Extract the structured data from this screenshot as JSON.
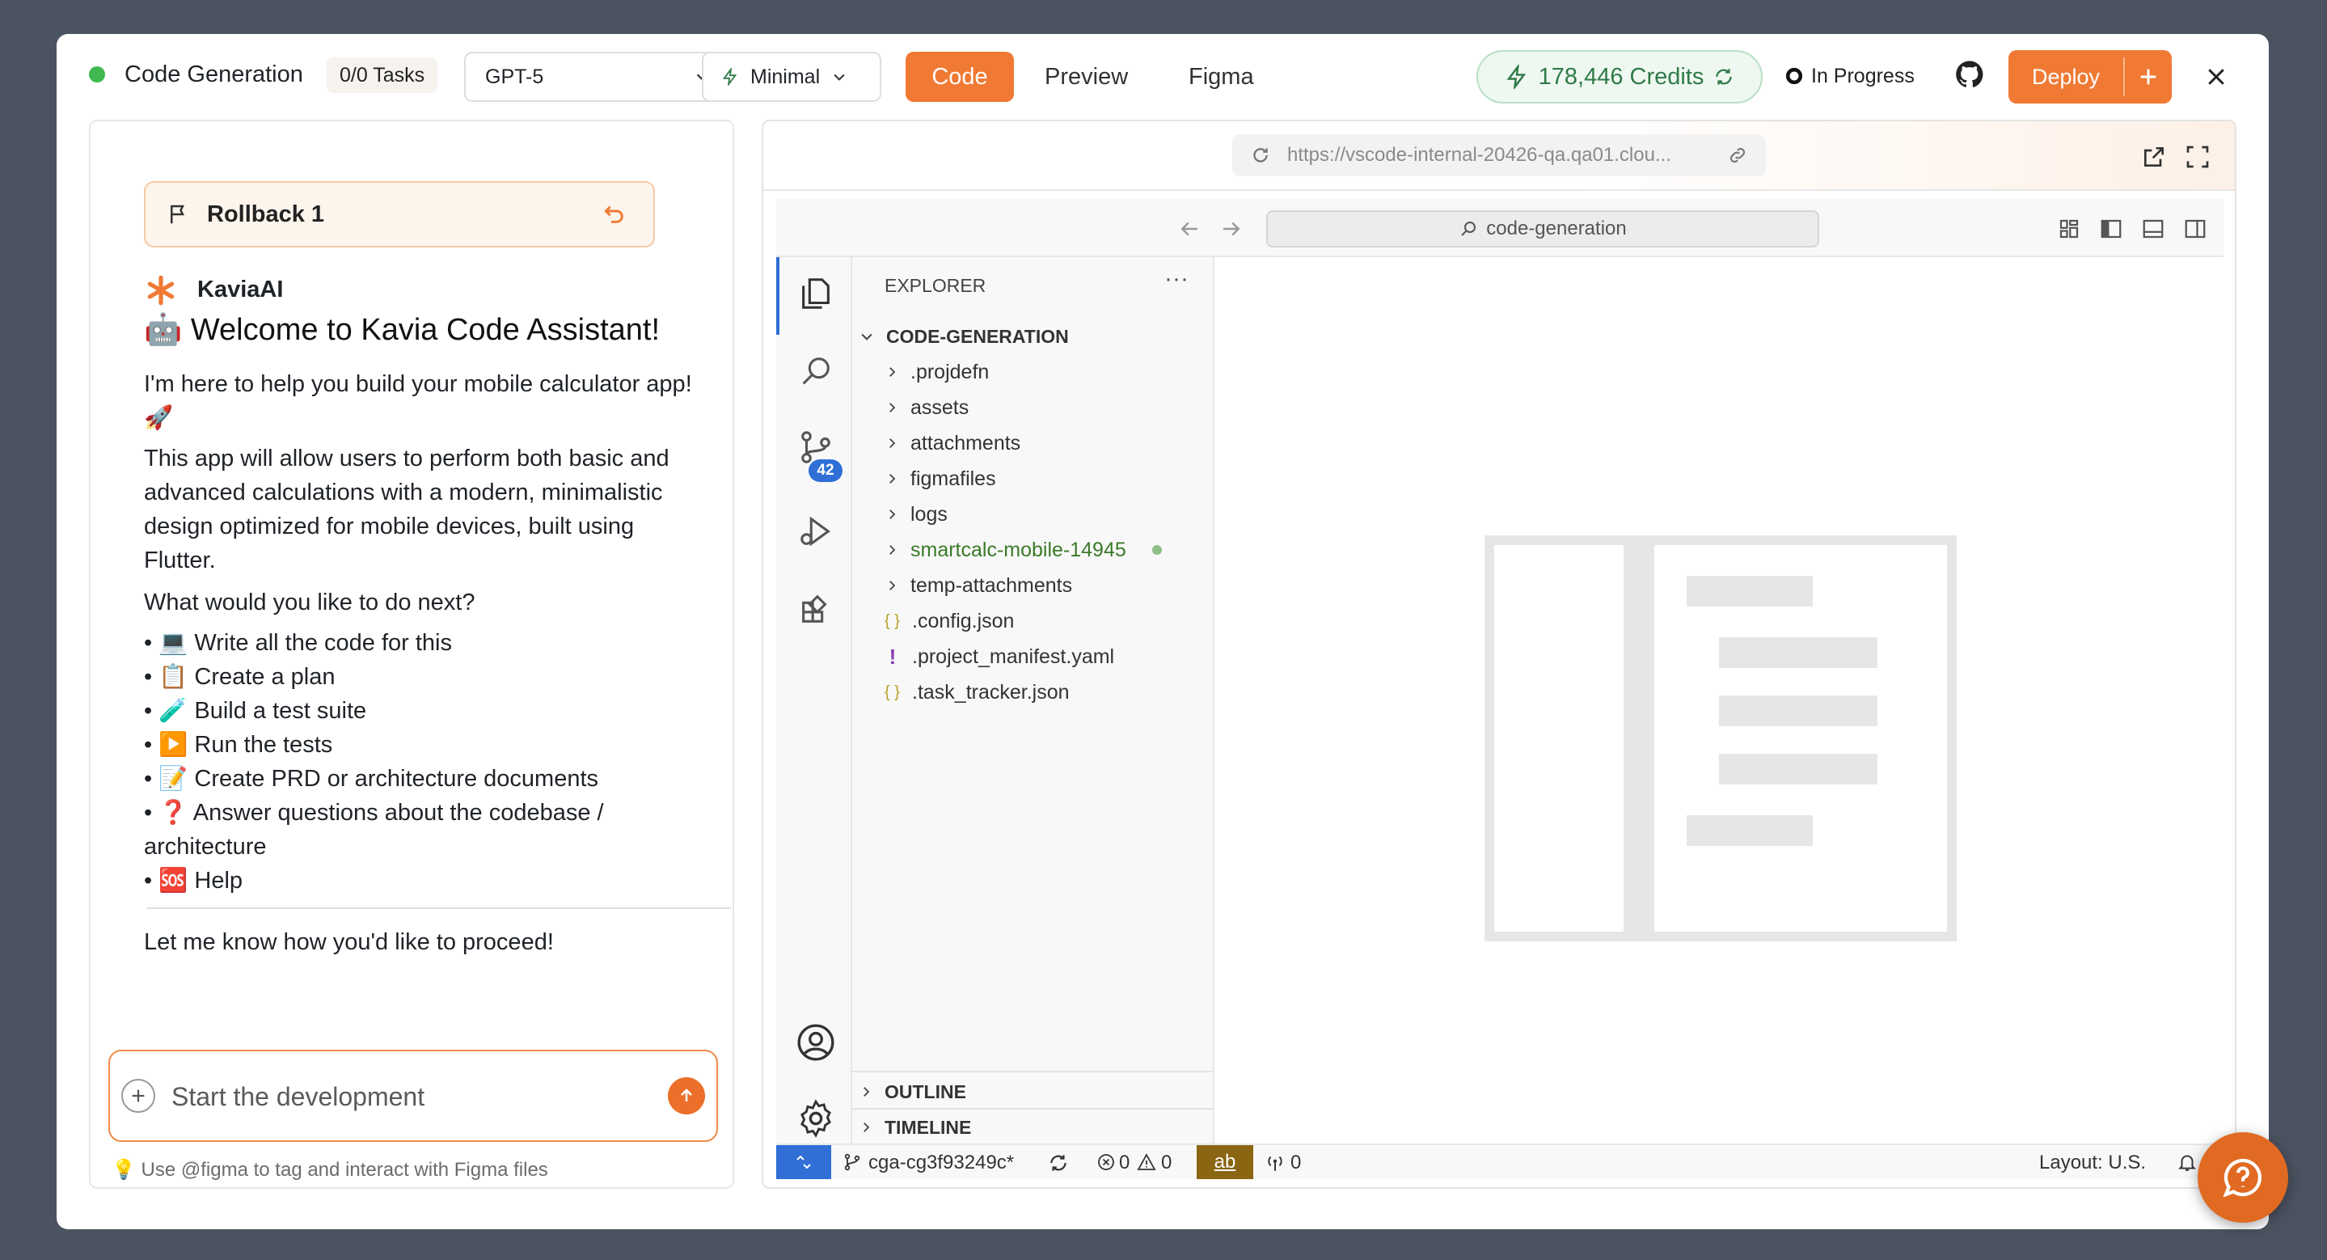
{
  "header": {
    "title": "Code Generation",
    "tasks": "0/0 Tasks",
    "model": "GPT-5",
    "mode": "Minimal",
    "tabs": [
      "Code",
      "Preview",
      "Figma"
    ],
    "credits": "178,446 Credits",
    "status": "In Progress",
    "deploy": "Deploy",
    "colors": {
      "accent": "#f07a34",
      "success": "#3fb950"
    }
  },
  "chat": {
    "rollback": "Rollback 1",
    "sender": "KaviaAI",
    "welcome": "🤖 Welcome to Kavia Code Assistant!",
    "intro_line1": "I'm here to help you build your mobile calculator app!",
    "intro_line2": "🚀",
    "desc_lines": [
      "This app will allow users to perform both basic and",
      "advanced calculations with a modern, minimalistic",
      "design optimized for mobile devices, built using",
      "Flutter."
    ],
    "question": "What would you like to do next?",
    "options": [
      "• 💻 Write all the code for this",
      "• 📋 Create a plan",
      "• 🧪 Build a test suite",
      "• ▶️ Run the tests",
      "• 📝 Create PRD or architecture documents",
      "• ❓ Answer questions about the codebase /",
      "architecture",
      "• 🆘 Help"
    ],
    "closing": "Let me know how you'd like to proceed!",
    "input_placeholder": "Start the development",
    "hint": "💡 Use @figma to tag and interact with Figma files"
  },
  "preview": {
    "url": "https://vscode-internal-20426-qa.qa01.clou..."
  },
  "vscode": {
    "search": "code-generation",
    "explorer_title": "EXPLORER",
    "scm_badge": "42",
    "root": "CODE-GENERATION",
    "folders": [
      ".projdefn",
      "assets",
      "attachments",
      "figmafiles",
      "logs",
      "smartcalc-mobile-14945",
      "temp-attachments"
    ],
    "files": [
      {
        "icon": "{ }",
        "name": ".config.json"
      },
      {
        "icon": "!",
        "name": ".project_manifest.yaml"
      },
      {
        "icon": "{ }",
        "name": ".task_tracker.json"
      }
    ],
    "outline": "OUTLINE",
    "timeline": "TIMELINE",
    "branch": "cga-cg3f93249c*",
    "errors": "0",
    "warnings": "0",
    "ab": "ab",
    "ports": "0",
    "layout": "Layout: U.S."
  }
}
